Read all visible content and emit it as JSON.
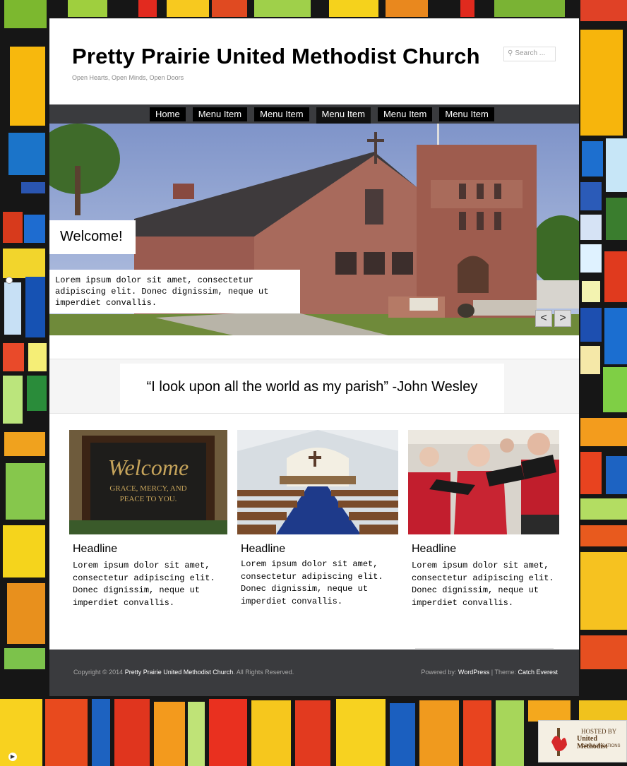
{
  "site": {
    "title": "Pretty Prairie United Methodist Church",
    "tagline": "Open Hearts, Open Minds, Open Doors",
    "search_placeholder": "Search ..."
  },
  "nav": {
    "items": [
      "Home",
      "Menu Item",
      "Menu Item",
      "Menu Item",
      "Menu Item",
      "Menu Item"
    ]
  },
  "slider": {
    "heading": "Welcome!",
    "text": "Lorem ipsum dolor sit amet, consectetur adipiscing elit. Donec dignissim, neque ut imperdiet convallis.",
    "prev": "<",
    "next": ">"
  },
  "quote": "“I look upon all the world as my parish” -John Wesley",
  "columns": [
    {
      "headline": "Headline",
      "sign_line1": "Welcome",
      "sign_line2": "GRACE, MERCY, AND",
      "sign_line3": "PEACE TO YOU.",
      "body": "Lorem ipsum dolor sit amet, consectetur adipiscing elit. Donec dignissim, neque ut imperdiet convallis."
    },
    {
      "headline": "Headline",
      "body": "Lorem ipsum dolor sit amet, consectetur adipiscing elit. Donec dignissim, neque ut imperdiet convallis."
    },
    {
      "headline": "Headline",
      "body": "Lorem ipsum dolor sit amet, consectetur adipiscing elit. Donec dignissim, neque ut imperdiet convallis."
    }
  ],
  "footer": {
    "copyright_prefix": "Copyright © 2014 ",
    "copyright_name": "Pretty Prairie United Methodist Church",
    "copyright_suffix": ". All Rights Reserved.",
    "powered_prefix": "Powered by: ",
    "powered_link": "WordPress",
    "theme_prefix": " | Theme: ",
    "theme_link": "Catch Everest"
  },
  "hosted": {
    "line1": "HOSTED BY",
    "line2": "United Methodist",
    "line3": "COMMUNICATIONS"
  },
  "colors": {
    "nav_bg": "#3a3b3e",
    "menu_item_bg": "#000000",
    "footer_bg": "#3a3b3e"
  }
}
